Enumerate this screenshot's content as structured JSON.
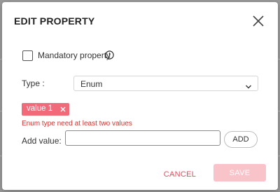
{
  "dialog": {
    "title": "EDIT PROPERTY",
    "close_icon": "close-icon"
  },
  "mandatory": {
    "label": "Mandatory property",
    "checked": false,
    "info_icon": "info-icon"
  },
  "type_field": {
    "label": "Type :",
    "selected": "Enum",
    "chevron_icon": "chevron-down-icon"
  },
  "values": [
    {
      "label": "value 1",
      "remove_icon": "close-icon"
    }
  ],
  "error_message": "Enum type need at least two values",
  "add_value": {
    "label": "Add value:",
    "input_value": "",
    "button_label": "ADD"
  },
  "footer": {
    "cancel_label": "CANCEL",
    "save_label": "SAVE"
  },
  "colors": {
    "accent": "#e84a5f",
    "chip_background": "#f06a79",
    "save_disabled": "#f9c3ca",
    "error": "#d0312d"
  }
}
